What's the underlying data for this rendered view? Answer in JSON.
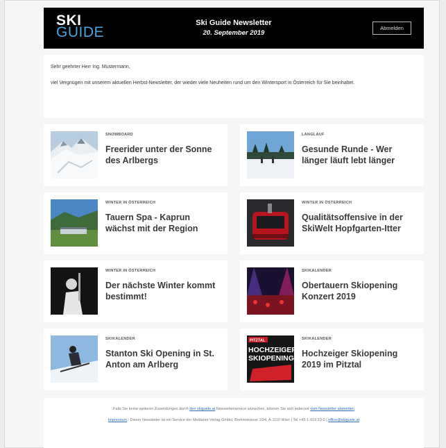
{
  "header": {
    "logo_line1": "SKI",
    "logo_line2": "GUIDE",
    "title": "Ski Guide Newsletter",
    "date": "20. September 2019",
    "button_label": "Abmelden"
  },
  "intro": {
    "greeting": "Sehr geehrter Herr Ing. Mustermann,",
    "text": "viel Vergnügen mit unserem aktuellen Herbst-Newsletter, der wieder viele Neuheiten rund um den Wintersport in Österreich für Sie beinhaltet."
  },
  "articles": [
    {
      "category": "SNOWBOARD",
      "title": "Freerider unter der Sonne des Arlbergs",
      "image": "snowy-mountain-image"
    },
    {
      "category": "LANGLAUF",
      "title": "Gesunde Runde - Wer länger läuft lebt länger",
      "image": "cross-country-image"
    },
    {
      "category": "WINTER IN ÖSTERREICH",
      "title": "Tauern Spa - Kaprun wächst mit der Region",
      "image": "spa-building-image"
    },
    {
      "category": "WINTER IN ÖSTERREICH",
      "title": "Qualitätsoffensive in der SkiWelt Hopfgarten-Itter",
      "image": "gondola-image"
    },
    {
      "category": "WINTER IN ÖSTERREICH",
      "title": "Der nächste Winter kommt bestimmt!",
      "image": "skier-bw-image"
    },
    {
      "category": "SKIKALENDER",
      "title": "Obertauern Skiopening Konzert 2019",
      "image": "concert-image"
    },
    {
      "category": "SKIKALENDER",
      "title": "Stanton Ski Opening in St. Anton am Arlberg",
      "image": "ski-jump-image"
    },
    {
      "category": "SKIKALENDER",
      "title": "Hochzeiger Skiopening 2019 im Pitztal",
      "image": "hochzeiger-poster-image"
    }
  ],
  "poster": {
    "top": "PITZTAL",
    "line1": "HOCHZEIGER",
    "line2": "SKIOPENING"
  },
  "footer": {
    "line1_pre": "Falls Sie keine weiteren Zusendungen durch",
    "line1_link1": "den skiguide.at",
    "line1_mid": "Newsletterservice wünschen, können Sie sich jederzeit",
    "line1_link2": "vom Newsletter abmelden",
    "impressum_label": "Impressum",
    "impressum_text": ": Dieser Newsletter ist ein Service der Medianet Verlag GmbH, Brehmstrasse 10/4, A-1110 Wien | Tel +43-1-919 20-0 |",
    "email": "office@skiguide.at"
  },
  "colors": {
    "header_bg": "#000000",
    "logo_accent": "#4aa3dd",
    "link": "#2f6eb5"
  }
}
